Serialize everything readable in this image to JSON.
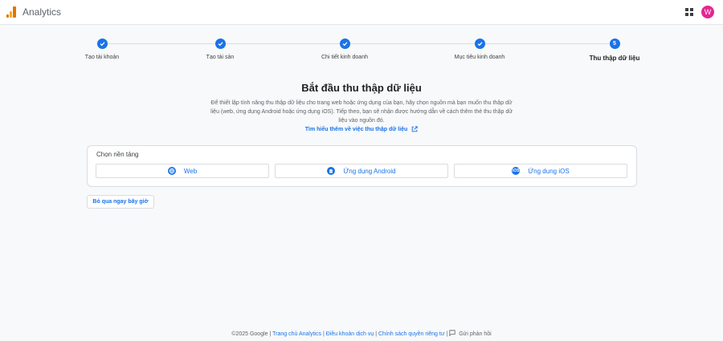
{
  "app": {
    "title": "Analytics",
    "avatar_initial": "W",
    "avatar_color": "#e52592",
    "accent_color": "#1a73e8"
  },
  "stepper": {
    "steps": [
      {
        "label": "Tạo tài khoản",
        "state": "complete"
      },
      {
        "label": "Tạo tài sản",
        "state": "complete"
      },
      {
        "label": "Chi tiết kinh doanh",
        "state": "complete"
      },
      {
        "label": "Mục tiêu kinh doanh",
        "state": "complete"
      },
      {
        "label": "Thu thập dữ liệu",
        "state": "active",
        "number": "5"
      }
    ]
  },
  "main": {
    "heading": "Bắt đầu thu thập dữ liệu",
    "description": "Để thiết lập tính năng thu thập dữ liệu cho trang web hoặc ứng dụng của bạn, hãy chọn nguồn mà bạn muốn thu thập dữ liệu (web, ứng dụng Android hoặc ứng dụng iOS). Tiếp theo, bạn sẽ nhận được hướng dẫn về cách thêm thẻ thu thập dữ liệu vào nguồn đó.",
    "learn_more": "Tìm hiểu thêm về việc thu thập dữ liệu"
  },
  "platform": {
    "title": "Chọn nền tảng",
    "options": [
      {
        "label": "Web",
        "icon": "globe-icon"
      },
      {
        "label": "Ứng dụng Android",
        "icon": "android-icon"
      },
      {
        "label": "Ứng dụng iOS",
        "icon": "ios-icon",
        "icon_text": "iOS"
      }
    ]
  },
  "skip_button": "Bỏ qua ngay bây giờ",
  "footer": {
    "copyright": "©2025 Google",
    "separator": "|",
    "links": [
      "Trang chủ Analytics",
      "Điều khoản dịch vụ",
      "Chính sách quyền riêng tư"
    ],
    "feedback": "Gửi phản hồi"
  }
}
